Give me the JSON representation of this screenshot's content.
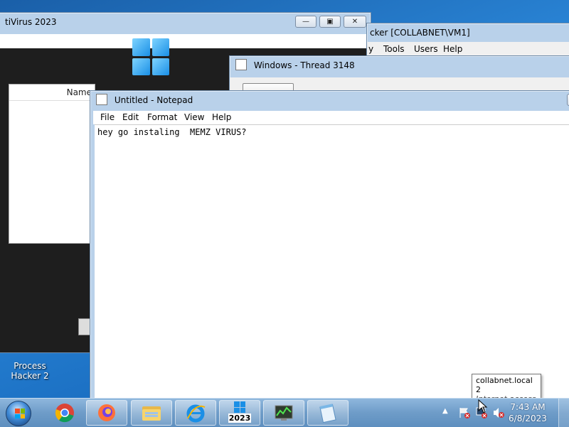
{
  "desktop": {
    "icon_label_line1": "Process",
    "icon_label_line2": "Hacker 2"
  },
  "antivirus_window": {
    "title": "tiVirus 2023",
    "list_header": "Name"
  },
  "process_hacker_window": {
    "title": "cker [COLLABNET\\VM1]",
    "menu": [
      "y",
      "Tools",
      "Users",
      "Help"
    ]
  },
  "thread_window": {
    "title": "Windows - Thread 3148"
  },
  "notepad": {
    "title": "Untitled - Notepad",
    "menu": [
      "File",
      "Edit",
      "Format",
      "View",
      "Help"
    ],
    "content": "hey go instaling  MEMZ VIRUS?"
  },
  "tooltip": {
    "line1": "collabnet.local  2",
    "line2": "Internet access"
  },
  "taskbar": {
    "apps": [
      "chrome-icon",
      "firefox-icon",
      "explorer-icon",
      "ie-icon",
      "antivirus-2023-icon",
      "process-hacker-icon",
      "notepad-icon"
    ],
    "av_badge": "2023",
    "clock_time": "7:43 AM",
    "clock_date": "6/8/2023"
  },
  "colors": {
    "taskbar": "#6e9cc8",
    "title_glass": "#b9d1ea",
    "desktop": "#2a86d8"
  }
}
